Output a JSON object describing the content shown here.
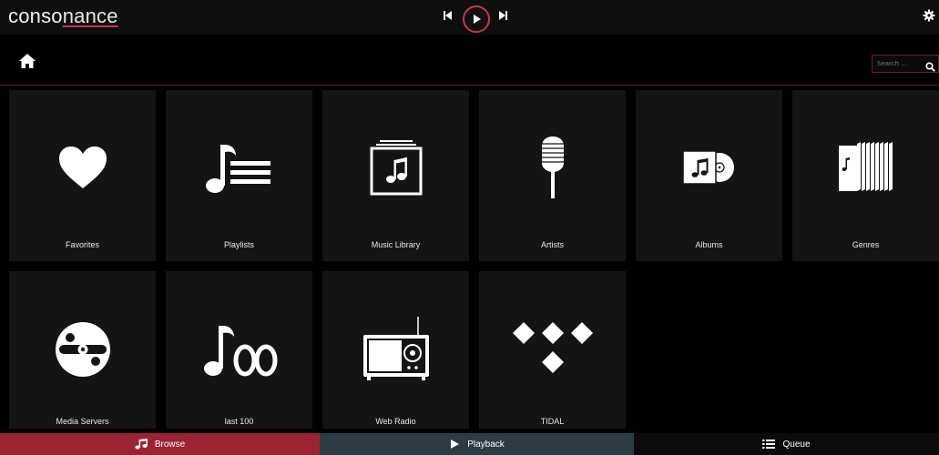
{
  "header": {
    "brand_prefix": "conso",
    "brand_accent": "nance",
    "accent_color": "#c0394b"
  },
  "transport": {
    "prev_icon": "skip-previous-icon",
    "play_icon": "play-icon",
    "next_icon": "skip-next-icon"
  },
  "settings": {
    "icon": "gear-icon"
  },
  "nav": {
    "home_icon": "home-icon"
  },
  "search": {
    "placeholder": "Search ...",
    "value": "",
    "icon": "search-icon"
  },
  "tiles": [
    {
      "label": "Favorites",
      "icon": "heart-icon"
    },
    {
      "label": "Playlists",
      "icon": "playlist-icon"
    },
    {
      "label": "Music Library",
      "icon": "music-library-icon"
    },
    {
      "label": "Artists",
      "icon": "microphone-icon"
    },
    {
      "label": "Albums",
      "icon": "album-icon"
    },
    {
      "label": "Genres",
      "icon": "genres-icon"
    },
    {
      "label": "Media Servers",
      "icon": "media-server-icon"
    },
    {
      "label": "last 100",
      "icon": "last-100-icon"
    },
    {
      "label": "Web Radio",
      "icon": "radio-icon"
    },
    {
      "label": "TIDAL",
      "icon": "tidal-icon"
    }
  ],
  "bottom_nav": {
    "browse": "Browse",
    "playback": "Playback",
    "queue": "Queue",
    "colors": {
      "browse": "#9b2433",
      "playback": "#2c3c44",
      "queue": "#0b0b0b"
    }
  }
}
